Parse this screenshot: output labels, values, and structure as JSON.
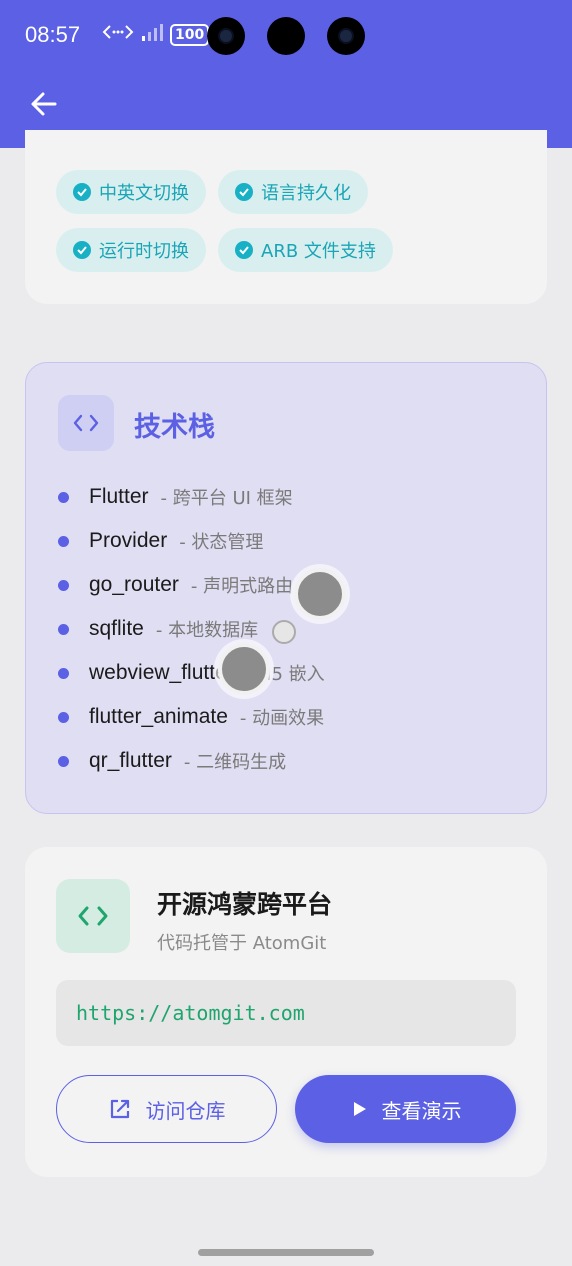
{
  "status_bar": {
    "time": "08:57",
    "battery": "100"
  },
  "features": {
    "chips": [
      {
        "label": "中英文切换"
      },
      {
        "label": "语言持久化"
      },
      {
        "label": "运行时切换"
      },
      {
        "label": "ARB 文件支持"
      }
    ]
  },
  "tech_stack": {
    "title": "技术栈",
    "items": [
      {
        "name": "Flutter",
        "desc": "- 跨平台 UI 框架"
      },
      {
        "name": "Provider",
        "desc": "- 状态管理"
      },
      {
        "name": "go_router",
        "desc": "- 声明式路由"
      },
      {
        "name": "sqflite",
        "desc": "- 本地数据库"
      },
      {
        "name": "webview_flutter",
        "desc": "- H5 嵌入"
      },
      {
        "name": "flutter_animate",
        "desc": "- 动画效果"
      },
      {
        "name": "qr_flutter",
        "desc": "- 二维码生成"
      }
    ]
  },
  "repo": {
    "title": "开源鸿蒙跨平台",
    "subtitle": "代码托管于 AtomGit",
    "url": "https://atomgit.com",
    "visit_label": "访问仓库",
    "demo_label": "查看演示"
  },
  "colors": {
    "header": "#5b60e4",
    "accent": "#5b60e4",
    "chip_text": "#1aa5b6",
    "url_text": "#1fa56e"
  },
  "icons": {
    "back": "arrow-left-icon",
    "code": "code-icon",
    "check": "check-circle-icon",
    "external": "external-link-icon",
    "play": "play-icon"
  }
}
